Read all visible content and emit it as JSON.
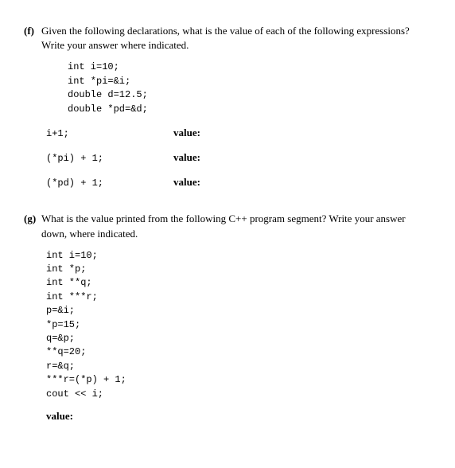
{
  "questions": {
    "f": {
      "marker": "(f)",
      "prompt": "Given the following declarations, what is the value of each of the following expressions? Write your answer where indicated.",
      "declarations": "int i=10;\nint *pi=&i;\ndouble d=12.5;\ndouble *pd=&d;",
      "expressions": [
        {
          "code": "i+1;",
          "label": "value:"
        },
        {
          "code": "(*pi) + 1;",
          "label": "value:"
        },
        {
          "code": "(*pd) + 1;",
          "label": "value:"
        }
      ]
    },
    "g": {
      "marker": "(g)",
      "prompt": "What is the value printed from the following C++ program segment? Write your answer down, where indicated.",
      "code": "int i=10;\nint *p;\nint **q;\nint ***r;\np=&i;\n*p=15;\nq=&p;\n**q=20;\nr=&q;\n***r=(*p) + 1;\ncout << i;",
      "value_label": "value:"
    }
  }
}
